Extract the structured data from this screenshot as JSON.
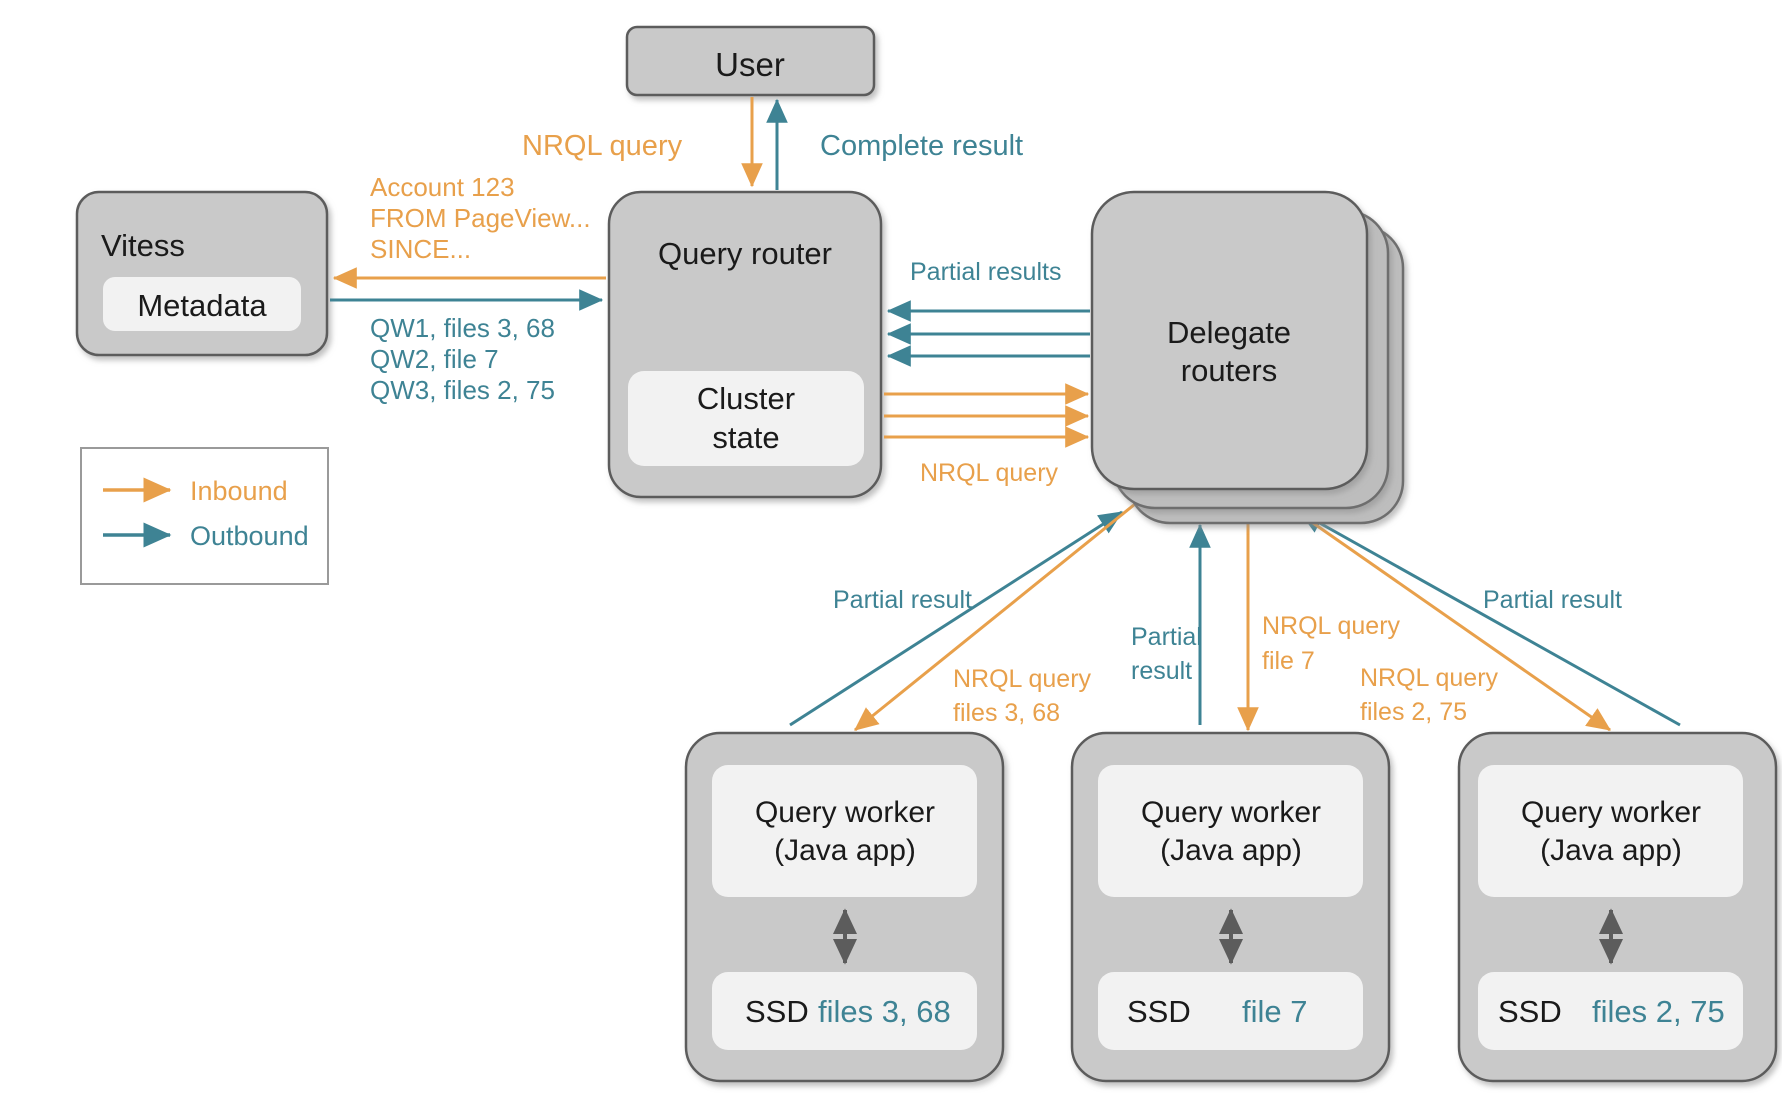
{
  "diagram": {
    "title": "NRQL distributed query execution flow",
    "colors": {
      "inbound": "#E8A04B",
      "outbound": "#3E8394",
      "node_fill": "#c9c9c9",
      "node_stroke": "#5c5c5c",
      "inner_fill": "#f2f2f2",
      "text": "#1a1a1a",
      "background": "#ffffff"
    },
    "nodes": {
      "user": {
        "label": "User"
      },
      "vitess": {
        "label": "Vitess",
        "inner_label": "Metadata"
      },
      "query_router": {
        "label": "Query router",
        "inner_label_line1": "Cluster",
        "inner_label_line2": "state"
      },
      "delegate_routers": {
        "label_line1": "Delegate",
        "label_line2": "routers",
        "stack_count": 3
      },
      "worker_left": {
        "label_line1": "Query worker",
        "label_line2": "(Java app)",
        "storage_label": "SSD",
        "storage_files": "files 3, 68"
      },
      "worker_middle": {
        "label_line1": "Query worker",
        "label_line2": "(Java app)",
        "storage_label": "SSD",
        "storage_files": "file 7"
      },
      "worker_right": {
        "label_line1": "Query worker",
        "label_line2": "(Java app)",
        "storage_label": "SSD",
        "storage_files": "files 2, 75"
      }
    },
    "legend": {
      "items": [
        {
          "label": "Inbound",
          "color": "#E8A04B"
        },
        {
          "label": "Outbound",
          "color": "#3E8394"
        }
      ]
    },
    "edge_labels": {
      "user_to_router": "NRQL query",
      "router_to_user": "Complete result",
      "router_to_vitess_l1": "Account 123",
      "router_to_vitess_l2": "FROM PageView...",
      "router_to_vitess_l3": "SINCE...",
      "vitess_to_router_l1": "QW1, files 3, 68",
      "vitess_to_router_l2": "QW2, file 7",
      "vitess_to_router_l3": "QW3, files 2, 75",
      "delegate_partial_results": "Partial results",
      "router_to_delegate_nrql": "NRQL query",
      "left_partial_result": "Partial result",
      "left_nrql_l1": "NRQL query",
      "left_nrql_l2": "files 3, 68",
      "mid_partial_result_l1": "Partial",
      "mid_partial_result_l2": "result",
      "mid_nrql_l1": "NRQL query",
      "mid_nrql_l2": "file 7",
      "right_nrql_l1": "NRQL query",
      "right_nrql_l2": "files 2, 75",
      "right_partial_result": "Partial result"
    }
  }
}
